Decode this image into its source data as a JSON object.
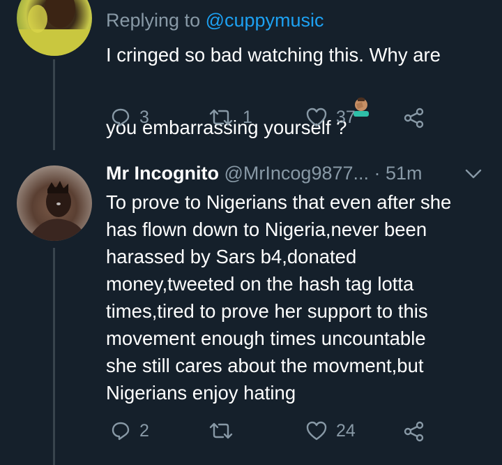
{
  "tweet1": {
    "reply_prefix": "Replying to ",
    "reply_handle": "@cuppymusic",
    "text": "I cringed so bad watching this. Why are\nyou embarrassing yourself ?",
    "emoji": "man-facepalming",
    "replies": "3",
    "retweets": "1",
    "likes": "37"
  },
  "tweet2": {
    "name": "Mr Incognito",
    "meta": "@MrIncog9877... · 51m",
    "text": "To prove to Nigerians that even after she\nhas flown down to Nigeria,never been\nharassed by Sars b4,donated\nmoney,tweeted on the hash tag lotta\ntimes,tired to prove her support to this\nmovement enough times uncountable\nshe still cares about the movment,but\nNigerians enjoy hating",
    "replies": "2",
    "retweets": "",
    "likes": "24"
  },
  "icons": [
    "reply-icon",
    "retweet-icon",
    "like-icon",
    "share-icon",
    "chevron-down-icon"
  ],
  "colors": {
    "background": "#15202b",
    "secondary": "#8899a6",
    "link": "#1da1f2",
    "thread_line": "#38444d"
  }
}
